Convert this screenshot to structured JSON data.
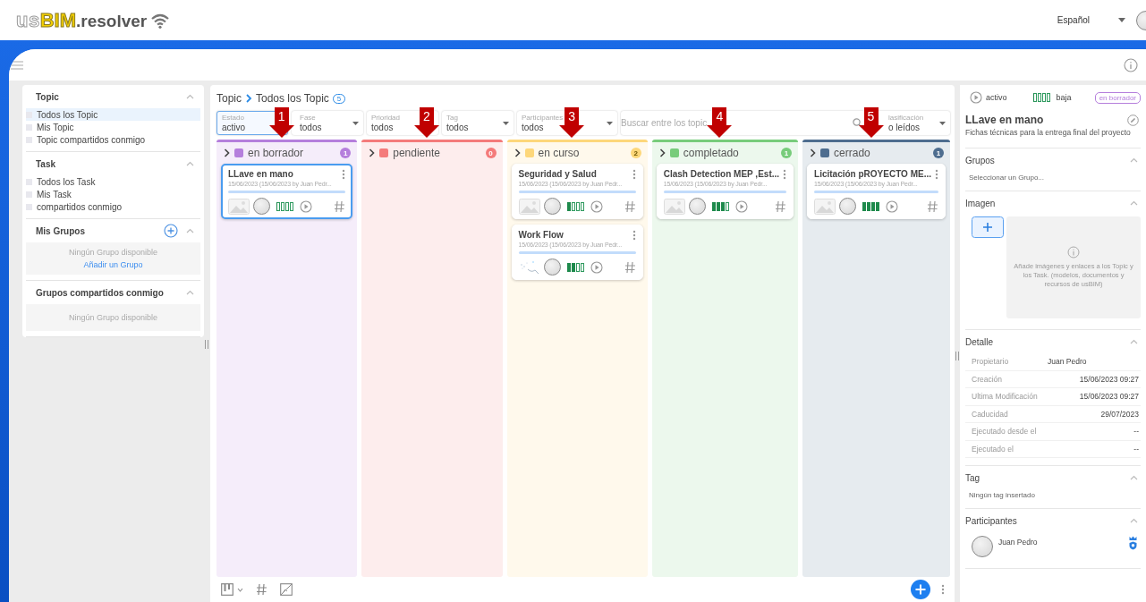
{
  "header": {
    "logo": {
      "outline": "us",
      "highlight": "BIM",
      "suffix": ".resolver"
    },
    "language": "Español"
  },
  "sidebar": {
    "sections": [
      {
        "title": "Topic",
        "kind": "list",
        "items": [
          {
            "label": "Todos los Topic",
            "selected": true
          },
          {
            "label": "Mis Topic",
            "selected": false
          },
          {
            "label": "Topic compartidos conmigo",
            "selected": false
          }
        ]
      },
      {
        "title": "Task",
        "kind": "list",
        "items": [
          {
            "label": "Todos los Task",
            "selected": false
          },
          {
            "label": "Mis Task",
            "selected": false
          },
          {
            "label": "compartidos conmigo",
            "selected": false
          }
        ]
      },
      {
        "title": "Mis Grupos",
        "kind": "empty",
        "add_button": true,
        "empty_text": "Ningún Grupo disponible",
        "link": "Añadir un Grupo"
      },
      {
        "title": "Grupos compartidos conmigo",
        "kind": "empty",
        "add_button": false,
        "empty_text": "Ningún Grupo disponible"
      }
    ]
  },
  "board": {
    "breadcrumb": {
      "root": "Topic",
      "current": "Todos los Topic",
      "count": "5"
    },
    "filters": [
      {
        "kind": "select",
        "label": "Estado",
        "value": "activo",
        "selected": true,
        "dropdown": false
      },
      {
        "kind": "select",
        "label": "Fase",
        "value": "todos",
        "selected": false,
        "dropdown": true
      },
      {
        "kind": "select",
        "label": "Prioridad",
        "value": "todos",
        "selected": false,
        "dropdown": false
      },
      {
        "kind": "select",
        "label": "Tag",
        "value": "todos",
        "selected": false,
        "dropdown": true
      },
      {
        "kind": "select",
        "label": "Participantes",
        "value": "todos",
        "selected": false,
        "dropdown": true
      },
      {
        "kind": "search",
        "placeholder": "Buscar entre los topic"
      },
      {
        "kind": "select",
        "label": "lasificación",
        "value": "o leídos",
        "selected": false,
        "dropdown": true
      }
    ],
    "columns": [
      {
        "name": "en borrador",
        "color": "#b57fdc",
        "count": "1",
        "callout": "1",
        "cards": [
          {
            "title": "LLave en mano",
            "meta": "15/06/2023 (15/06/2023 by Juan Pedr...",
            "selected": true,
            "kind": "empty",
            "level": 0
          }
        ]
      },
      {
        "name": "pendiente",
        "color": "#f47b7b",
        "count": "0",
        "callout": "2"
      },
      {
        "name": "en curso",
        "color": "#fdd77a",
        "count": "2",
        "callout": "3",
        "cards": [
          {
            "title": "Seguridad y Salud",
            "meta": "15/06/2023 (15/06/2023 by Juan Pedr...",
            "selected": false,
            "kind": "empty",
            "level": 0.25
          },
          {
            "title": "Work Flow",
            "meta": "15/06/2023 (15/06/2023 by Juan Pedr...",
            "selected": false,
            "kind": "picture",
            "level": 0.5
          }
        ]
      },
      {
        "name": "completado",
        "color": "#78cc7b",
        "count": "1",
        "callout": "4",
        "cards": [
          {
            "title": "Clash Detection MEP ,Est...",
            "meta": "15/06/2023 (15/06/2023 by Juan Pedr...",
            "selected": false,
            "kind": "empty",
            "level": 0.75
          }
        ]
      },
      {
        "name": "cerrado",
        "color": "#4e6d8f",
        "count": "1",
        "callout": "5",
        "cards": [
          {
            "title": "Licitación pROYECTO ME...",
            "meta": "15/06/2023 (15/06/2023 by Juan Pedr...",
            "selected": false,
            "kind": "empty",
            "level": 1
          }
        ]
      }
    ]
  },
  "detail": {
    "status": "activo",
    "priority": {
      "label": "baja",
      "level": 0
    },
    "badge": {
      "label": "en borrador",
      "color": "#b57fdc"
    },
    "title": "LLave en mano",
    "description": "Fichas técnicas para la entrega final del proyecto",
    "sections": [
      {
        "title": "Grupos",
        "kind": "text",
        "text": "Seleccionar un Grupo..."
      },
      {
        "title": "Imagen",
        "kind": "dropzone",
        "text": "Añade imágenes y enlaces a los Topic y los Task. (modelos, documentos y recursos de usBIM)"
      },
      {
        "title": "Detalle",
        "kind": "fields",
        "fields": [
          {
            "label": "Propietario",
            "value": "Juan Pedro",
            "kind": "user"
          },
          {
            "label": "Creación",
            "value": "15/06/2023 09:27",
            "kind": "text"
          },
          {
            "label": "Ultima Modificación",
            "value": "15/06/2023 09:27",
            "kind": "text"
          },
          {
            "label": "Caducidad",
            "value": "29/07/2023",
            "kind": "text"
          },
          {
            "label": "Ejecutado desde el",
            "value": "--",
            "kind": "text"
          },
          {
            "label": "Ejecutado el",
            "value": "--",
            "kind": "text"
          }
        ]
      },
      {
        "title": "Tag",
        "kind": "text",
        "text": "Ningún tag insertado"
      },
      {
        "title": "Participantes",
        "kind": "people",
        "people": [
          {
            "name": "Juan Pedro",
            "owner": true
          }
        ]
      }
    ]
  }
}
